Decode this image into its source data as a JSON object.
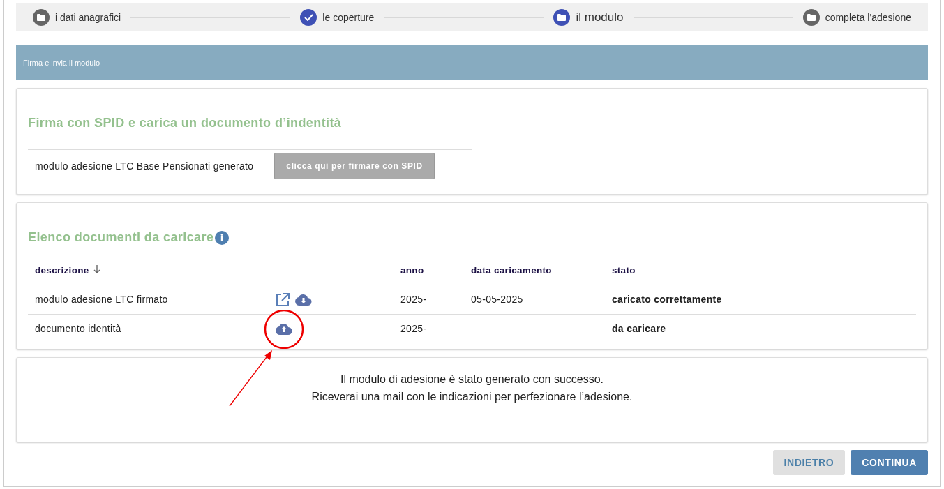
{
  "stepper": [
    {
      "label": "i dati anagrafici",
      "done": false,
      "selected": false
    },
    {
      "label": "le coperture",
      "done": true,
      "selected": false
    },
    {
      "label": "il modulo",
      "done": false,
      "selected": true
    },
    {
      "label": "completa l'adesione",
      "done": false,
      "selected": false
    }
  ],
  "header": {
    "title": "Firma e invia il modulo"
  },
  "sign_card": {
    "title": "Firma con SPID e carica un documento d’indentità",
    "document": "modulo adesione LTC Base Pensionati generato",
    "button": {
      "label": "clicca qui per firmare con SPID",
      "disabled": true
    }
  },
  "documents_card": {
    "title": "Elenco documenti da caricare",
    "columns": [
      {
        "label": "descrizione",
        "sorted": true
      },
      {
        "sorted": false
      },
      {
        "label": "anno",
        "sorted": false
      },
      {
        "label": "data caricamento",
        "sorted": false
      },
      {
        "label": "stato",
        "sorted": false
      }
    ],
    "rows": [
      {
        "descrizione": "modulo adesione LTC firmato",
        "actions": [
          {
            "kind": "open"
          },
          {
            "kind": "download"
          }
        ],
        "anno": "2025-",
        "data": "05-05-2025",
        "stato": "caricato correttamente",
        "highlighted": false
      },
      {
        "descrizione": "documento identità",
        "actions": [
          {
            "kind": "upload"
          }
        ],
        "anno": "2025-",
        "stato": "da caricare",
        "highlighted": true
      }
    ]
  },
  "message": {
    "lines": [
      "Il modulo di adesione è stato generato con successo.",
      "Riceverai una mail con le indicazioni per perfezionare l’adesione."
    ]
  },
  "buttons": [
    {
      "label": "INDIETRO",
      "kind": "secondary"
    },
    {
      "label": "CONTINUA",
      "kind": "primary"
    }
  ]
}
